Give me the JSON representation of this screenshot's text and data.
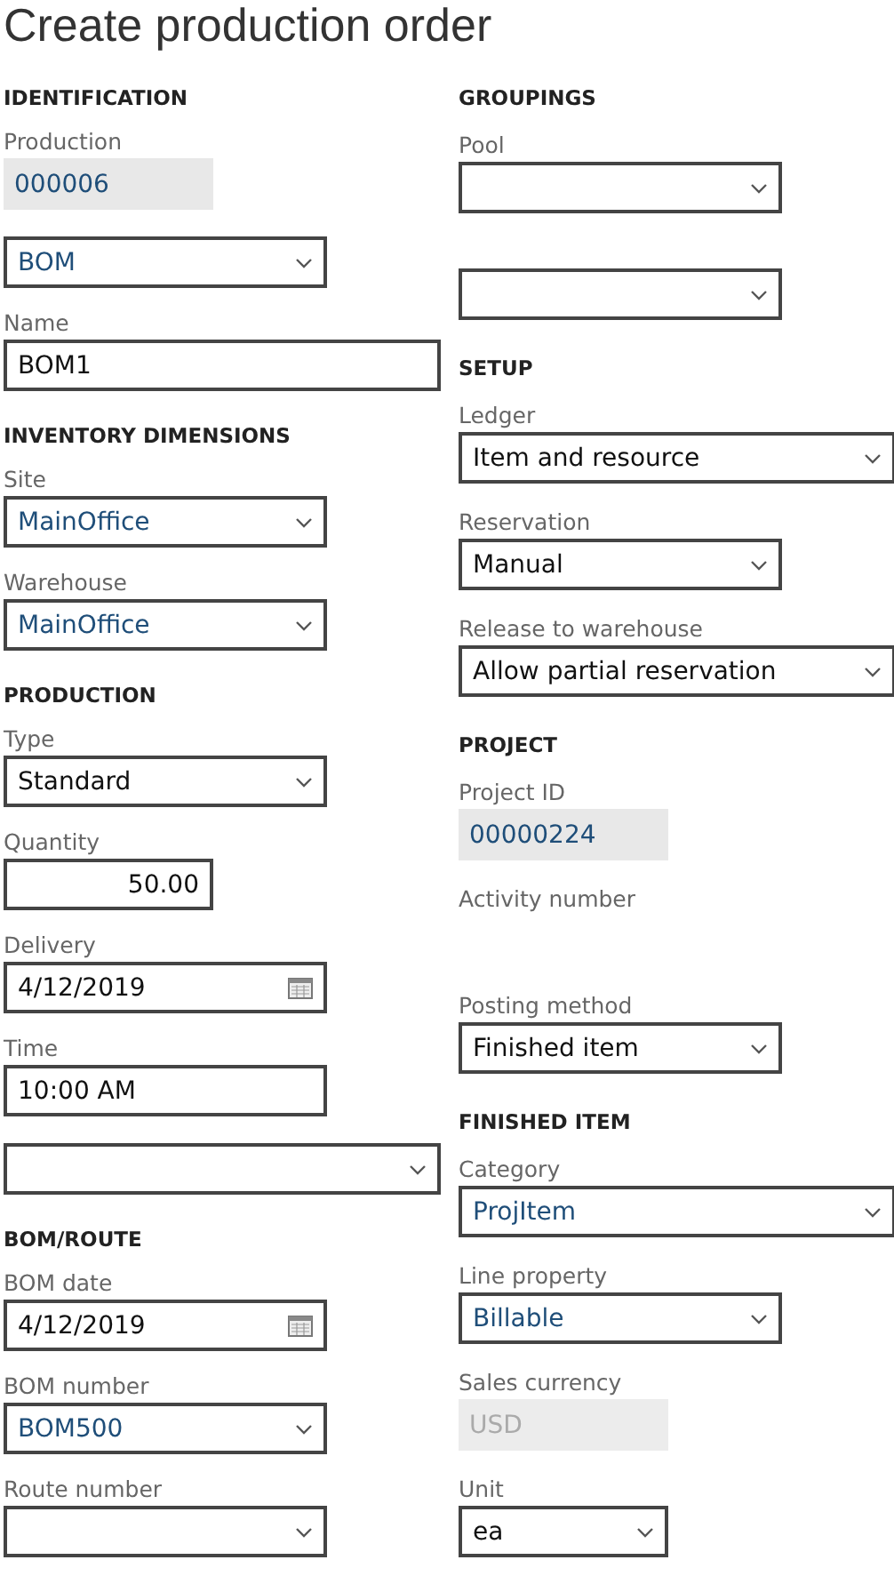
{
  "title": "Create production order",
  "columns": [
    [
      {
        "kind": "heading",
        "text": "IDENTIFICATION"
      },
      {
        "kind": "readonly",
        "label": "Production",
        "value": "000006",
        "link": true,
        "narrow": true,
        "wide": false,
        "disabled": false
      },
      {
        "kind": "select",
        "value": "BOM",
        "link": true,
        "narrow": false,
        "wide": false
      },
      {
        "kind": "text",
        "label": "Name",
        "value": "BOM1",
        "link": false,
        "narrow": false,
        "wide": true
      },
      {
        "kind": "heading",
        "text": "INVENTORY DIMENSIONS"
      },
      {
        "kind": "select",
        "label": "Site",
        "value": "MainOffice",
        "link": true,
        "narrow": false,
        "wide": false
      },
      {
        "kind": "select",
        "label": "Warehouse",
        "value": "MainOffice",
        "link": true,
        "narrow": false,
        "wide": false
      },
      {
        "kind": "heading",
        "text": "PRODUCTION"
      },
      {
        "kind": "select",
        "label": "Type",
        "value": "Standard",
        "link": false,
        "narrow": false,
        "wide": false
      },
      {
        "kind": "number",
        "label": "Quantity",
        "value": "50.00",
        "link": false,
        "narrow": true,
        "wide": false
      },
      {
        "kind": "date",
        "label": "Delivery",
        "value": "4/12/2019",
        "link": false,
        "narrow": false,
        "wide": false
      },
      {
        "kind": "text",
        "label": "Time",
        "value": "10:00 AM",
        "link": false,
        "narrow": false,
        "wide": false
      },
      {
        "kind": "select",
        "narrow": false,
        "wide": true
      },
      {
        "kind": "heading",
        "text": "BOM/ROUTE"
      },
      {
        "kind": "date",
        "label": "BOM date",
        "value": "4/12/2019",
        "link": false,
        "narrow": false,
        "wide": false
      },
      {
        "kind": "select",
        "label": "BOM number",
        "value": "BOM500",
        "link": true,
        "narrow": false,
        "wide": false
      },
      {
        "kind": "select",
        "label": "Route number",
        "narrow": false,
        "wide": false
      }
    ],
    [
      {
        "kind": "heading",
        "text": "GROUPINGS"
      },
      {
        "kind": "select",
        "label": "Pool",
        "narrow": false,
        "wide": false
      },
      {
        "kind": "select",
        "narrow": false,
        "wide": false
      },
      {
        "kind": "heading",
        "text": "SETUP"
      },
      {
        "kind": "select",
        "label": "Ledger",
        "value": "Item and resource",
        "link": false,
        "narrow": false,
        "wide": true
      },
      {
        "kind": "select",
        "label": "Reservation",
        "value": "Manual",
        "link": false,
        "narrow": false,
        "wide": false
      },
      {
        "kind": "select",
        "label": "Release to warehouse",
        "value": "Allow partial reservation",
        "link": false,
        "narrow": false,
        "wide": true
      },
      {
        "kind": "heading",
        "text": "PROJECT"
      },
      {
        "kind": "readonly",
        "label": "Project ID",
        "value": "00000224",
        "link": true,
        "narrow": true,
        "wide": false,
        "disabled": false
      },
      {
        "kind": "label",
        "label": "Activity number"
      },
      {
        "kind": "select",
        "label": "Posting method",
        "value": "Finished item",
        "link": false,
        "narrow": false,
        "wide": false
      },
      {
        "kind": "heading",
        "text": "FINISHED ITEM"
      },
      {
        "kind": "select",
        "label": "Category",
        "value": "ProjItem",
        "link": true,
        "narrow": false,
        "wide": true
      },
      {
        "kind": "select",
        "label": "Line property",
        "value": "Billable",
        "link": true,
        "narrow": false,
        "wide": false
      },
      {
        "kind": "readonly",
        "label": "Sales currency",
        "value": "USD",
        "link": false,
        "narrow": true,
        "wide": false,
        "disabled": true
      },
      {
        "kind": "select",
        "label": "Unit",
        "value": "ea",
        "link": false,
        "narrow": true,
        "wide": false
      }
    ]
  ]
}
